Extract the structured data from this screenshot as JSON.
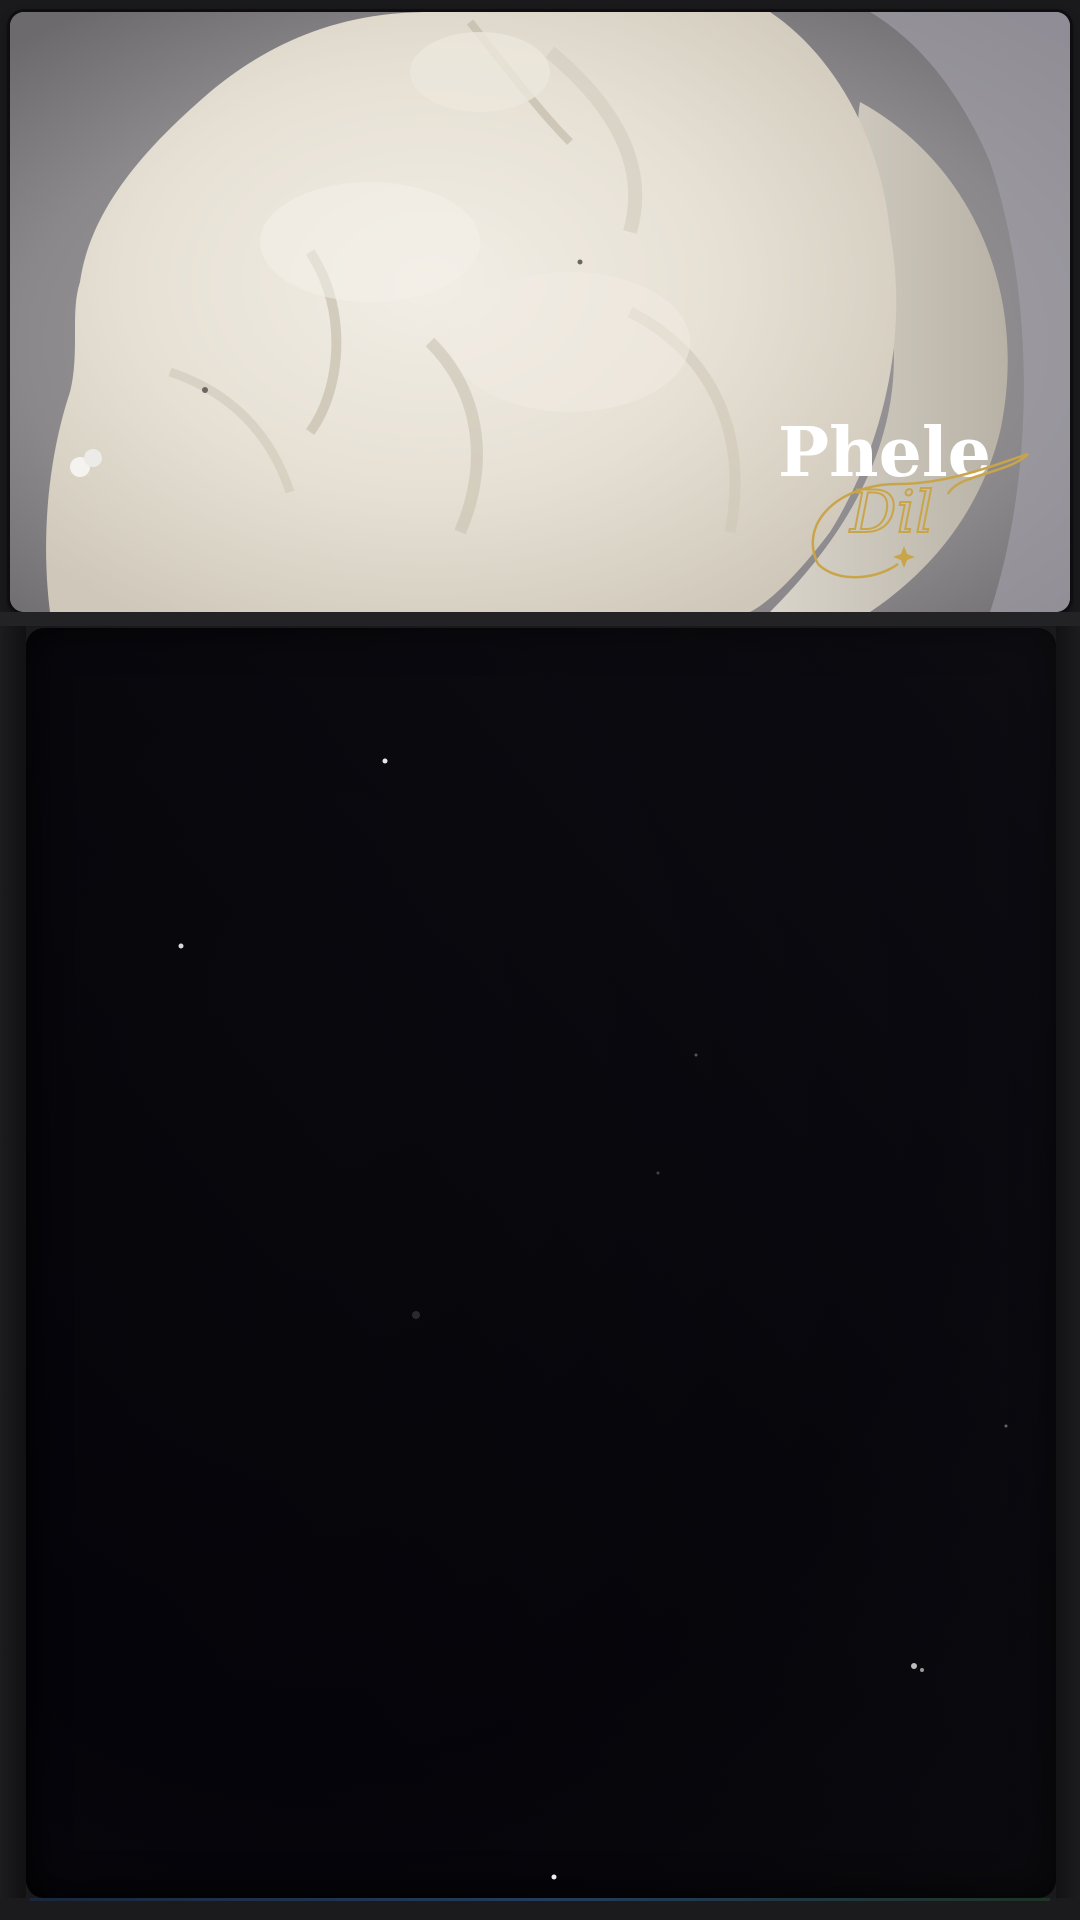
{
  "watermark": {
    "brand": "Phele Dil",
    "colors": {
      "brand_primary": "#ffffff",
      "brand_script": "#c9a54a"
    }
  },
  "video_panel": {
    "state": "dark frame"
  }
}
